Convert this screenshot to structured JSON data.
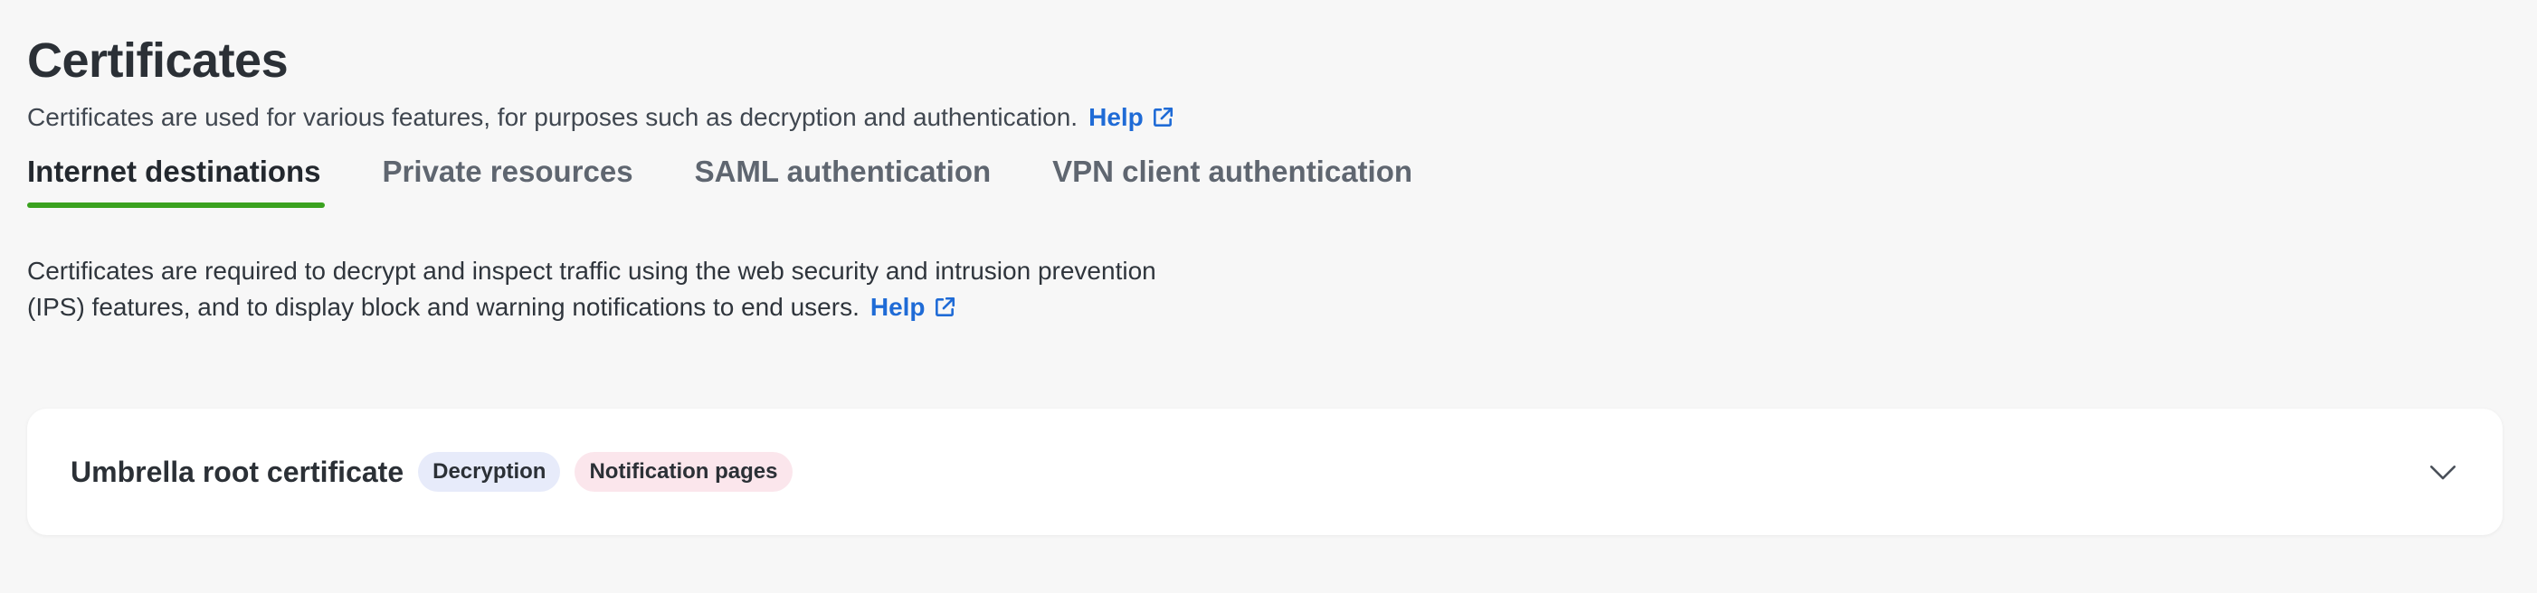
{
  "page": {
    "title": "Certificates",
    "description": "Certificates are used for various features, for purposes such as decryption and authentication.",
    "help_label": "Help"
  },
  "tabs": [
    {
      "label": "Internet destinations",
      "active": true
    },
    {
      "label": "Private resources",
      "active": false
    },
    {
      "label": "SAML authentication",
      "active": false
    },
    {
      "label": "VPN client authentication",
      "active": false
    }
  ],
  "section": {
    "description_line1": "Certificates are required to decrypt and inspect traffic using the web security and intrusion prevention",
    "description_line2": "(IPS) features, and to display block and warning notifications to end users.",
    "help_label": "Help"
  },
  "card": {
    "title": "Umbrella root certificate",
    "badges": [
      {
        "label": "Decryption",
        "color": "#e7ebfa"
      },
      {
        "label": "Notification pages",
        "color": "#fbe6ec"
      }
    ],
    "expand_icon": "chevron-down-icon"
  },
  "colors": {
    "link": "#1f6bd6",
    "active_tab_indicator": "#3aa21f",
    "background": "#f7f7f7"
  }
}
